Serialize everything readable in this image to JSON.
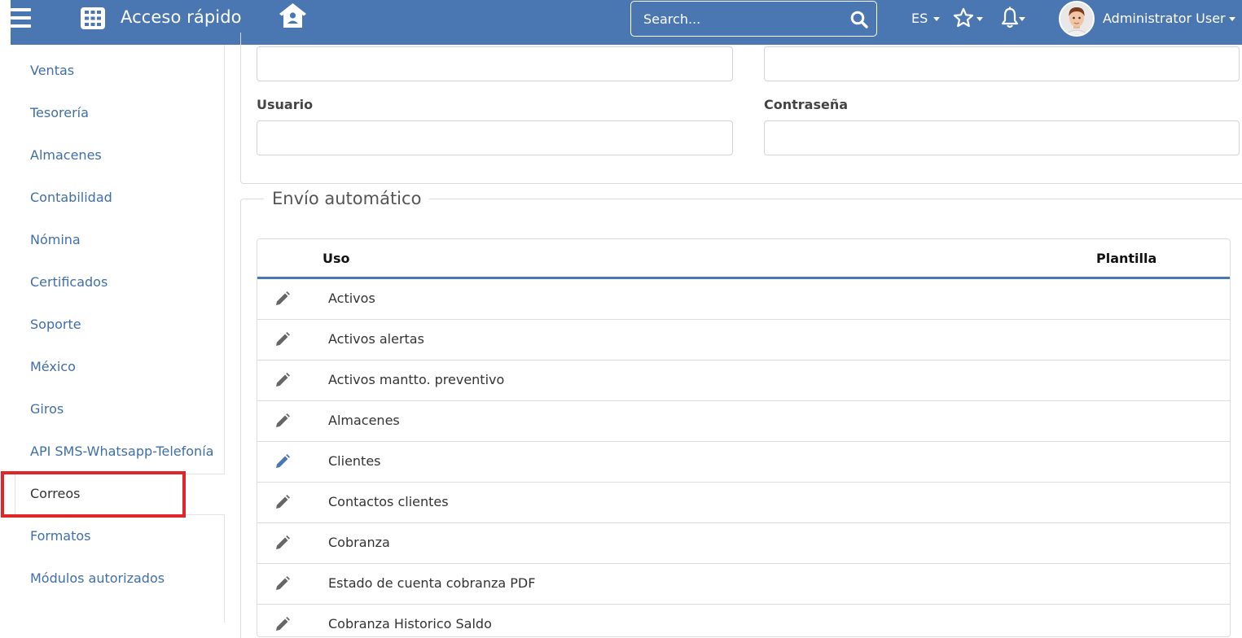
{
  "header": {
    "quick_access_label": "Acceso rápido",
    "search_placeholder": "Search...",
    "language": "ES",
    "user_name": "Administrator User",
    "accent_color": "#4a77b2"
  },
  "sidebar": {
    "items": [
      {
        "label": "Ventas"
      },
      {
        "label": "Tesorería"
      },
      {
        "label": "Almacenes"
      },
      {
        "label": "Contabilidad"
      },
      {
        "label": "Nómina"
      },
      {
        "label": "Certificados"
      },
      {
        "label": "Soporte"
      },
      {
        "label": "México"
      },
      {
        "label": "Giros"
      },
      {
        "label": "API SMS-Whatsapp-Telefonía"
      },
      {
        "label": "Correos",
        "active": true
      },
      {
        "label": "Formatos"
      },
      {
        "label": "Módulos autorizados"
      }
    ],
    "highlight_color": "#e0262a"
  },
  "form": {
    "user_label": "Usuario",
    "password_label": "Contraseña"
  },
  "auto_send": {
    "legend": "Envío automático",
    "columns": [
      "Uso",
      "Plantilla"
    ],
    "rows": [
      {
        "uso": "Activos",
        "plantilla": "",
        "edit_highlighted": false
      },
      {
        "uso": "Activos alertas",
        "plantilla": "",
        "edit_highlighted": false
      },
      {
        "uso": "Activos mantto. preventivo",
        "plantilla": "",
        "edit_highlighted": false
      },
      {
        "uso": "Almacenes",
        "plantilla": "",
        "edit_highlighted": false
      },
      {
        "uso": "Clientes",
        "plantilla": "",
        "edit_highlighted": true
      },
      {
        "uso": "Contactos clientes",
        "plantilla": "",
        "edit_highlighted": false
      },
      {
        "uso": "Cobranza",
        "plantilla": "",
        "edit_highlighted": false
      },
      {
        "uso": "Estado de cuenta cobranza PDF",
        "plantilla": "",
        "edit_highlighted": false
      },
      {
        "uso": "Cobranza Historico Saldo",
        "plantilla": "",
        "edit_highlighted": false
      }
    ]
  }
}
